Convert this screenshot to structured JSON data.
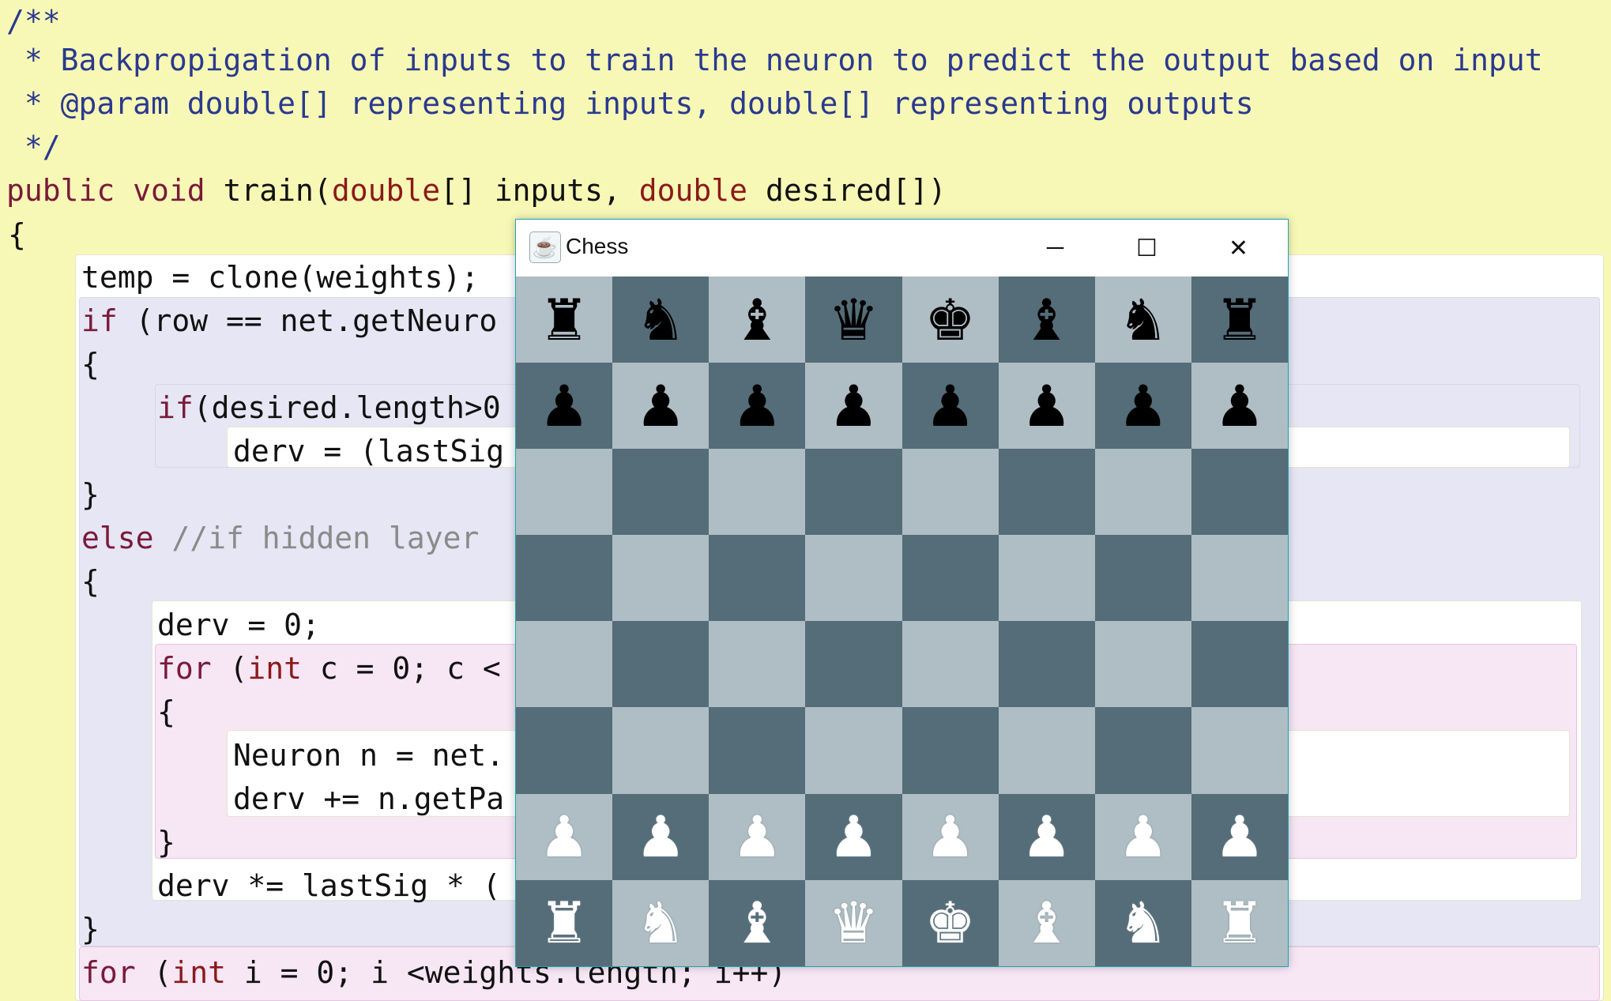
{
  "code": {
    "lines": [
      [
        {
          "t": "/**",
          "c": "cm"
        }
      ],
      [
        {
          "t": " * Backpropigation of inputs to train the neuron to predict the output based on input",
          "c": "cm"
        }
      ],
      [
        {
          "t": " * @param double[] representing inputs, double[] representing outputs",
          "c": "cm"
        }
      ],
      [
        {
          "t": " */",
          "c": "cm"
        }
      ],
      [
        {
          "t": "public void ",
          "c": "kw2"
        },
        {
          "t": "train(",
          "c": ""
        },
        {
          "t": "double",
          "c": "kw"
        },
        {
          "t": "[] inputs, ",
          "c": ""
        },
        {
          "t": "double",
          "c": "kw"
        },
        {
          "t": " desired[])",
          "c": ""
        }
      ],
      [
        {
          "t": "{",
          "c": ""
        }
      ],
      [
        {
          "t": "temp = clone(weights);",
          "c": ""
        }
      ],
      [
        {
          "t": "if",
          "c": "kw2"
        },
        {
          "t": " (row == net.getNeuro",
          "c": ""
        }
      ],
      [
        {
          "t": "{",
          "c": ""
        }
      ],
      [
        {
          "t": "if",
          "c": "kw2"
        },
        {
          "t": "(desired.length>0",
          "c": ""
        }
      ],
      [
        {
          "t": "derv = (lastSig",
          "c": ""
        }
      ],
      [
        {
          "t": "}",
          "c": ""
        }
      ],
      [
        {
          "t": "else",
          "c": "kw2"
        },
        {
          "t": " ",
          "c": ""
        },
        {
          "t": "//if hidden layer",
          "c": "lc"
        }
      ],
      [
        {
          "t": "{",
          "c": ""
        }
      ],
      [
        {
          "t": "derv = 0;",
          "c": ""
        }
      ],
      [
        {
          "t": "for",
          "c": "kw2"
        },
        {
          "t": " (",
          "c": ""
        },
        {
          "t": "int",
          "c": "kw"
        },
        {
          "t": " c = 0; c <",
          "c": ""
        }
      ],
      [
        {
          "t": "{",
          "c": ""
        }
      ],
      [
        {
          "t": "Neuron n = net.",
          "c": ""
        }
      ],
      [
        {
          "t": "derv += n.getPa",
          "c": ""
        }
      ],
      [
        {
          "t": "}",
          "c": ""
        }
      ],
      [
        {
          "t": "derv *= lastSig * (",
          "c": ""
        }
      ],
      [
        {
          "t": "}",
          "c": ""
        }
      ],
      [
        {
          "t": "for",
          "c": "kw2"
        },
        {
          "t": " (",
          "c": ""
        },
        {
          "t": "int",
          "c": "kw"
        },
        {
          "t": " i = 0; i <weights.length; i++)",
          "c": ""
        }
      ]
    ]
  },
  "window": {
    "title": "Chess",
    "app_icon": "java-cup-icon",
    "minimize_glyph": "─",
    "maximize_glyph": "☐",
    "close_glyph": "✕"
  },
  "board": {
    "light_color": "#afbdc4",
    "dark_color": "#546d78",
    "rows": [
      [
        "♜",
        "♞",
        "♝",
        "♛",
        "♚",
        "♝",
        "♞",
        "♜"
      ],
      [
        "♟",
        "♟",
        "♟",
        "♟",
        "♟",
        "♟",
        "♟",
        "♟"
      ],
      [
        "",
        "",
        "",
        "",
        "",
        "",
        "",
        ""
      ],
      [
        "",
        "",
        "",
        "",
        "",
        "",
        "",
        ""
      ],
      [
        "",
        "",
        "",
        "",
        "",
        "",
        "",
        ""
      ],
      [
        "",
        "",
        "",
        "",
        "",
        "",
        "",
        ""
      ],
      [
        "♟",
        "♟",
        "♟",
        "♟",
        "♟",
        "♟",
        "♟",
        "♟"
      ],
      [
        "♜",
        "♞",
        "♝",
        "♛",
        "♚",
        "♝",
        "♞",
        "♜"
      ]
    ],
    "row_colors": [
      "black",
      "black",
      "",
      "",
      "",
      "",
      "white",
      "white"
    ]
  }
}
